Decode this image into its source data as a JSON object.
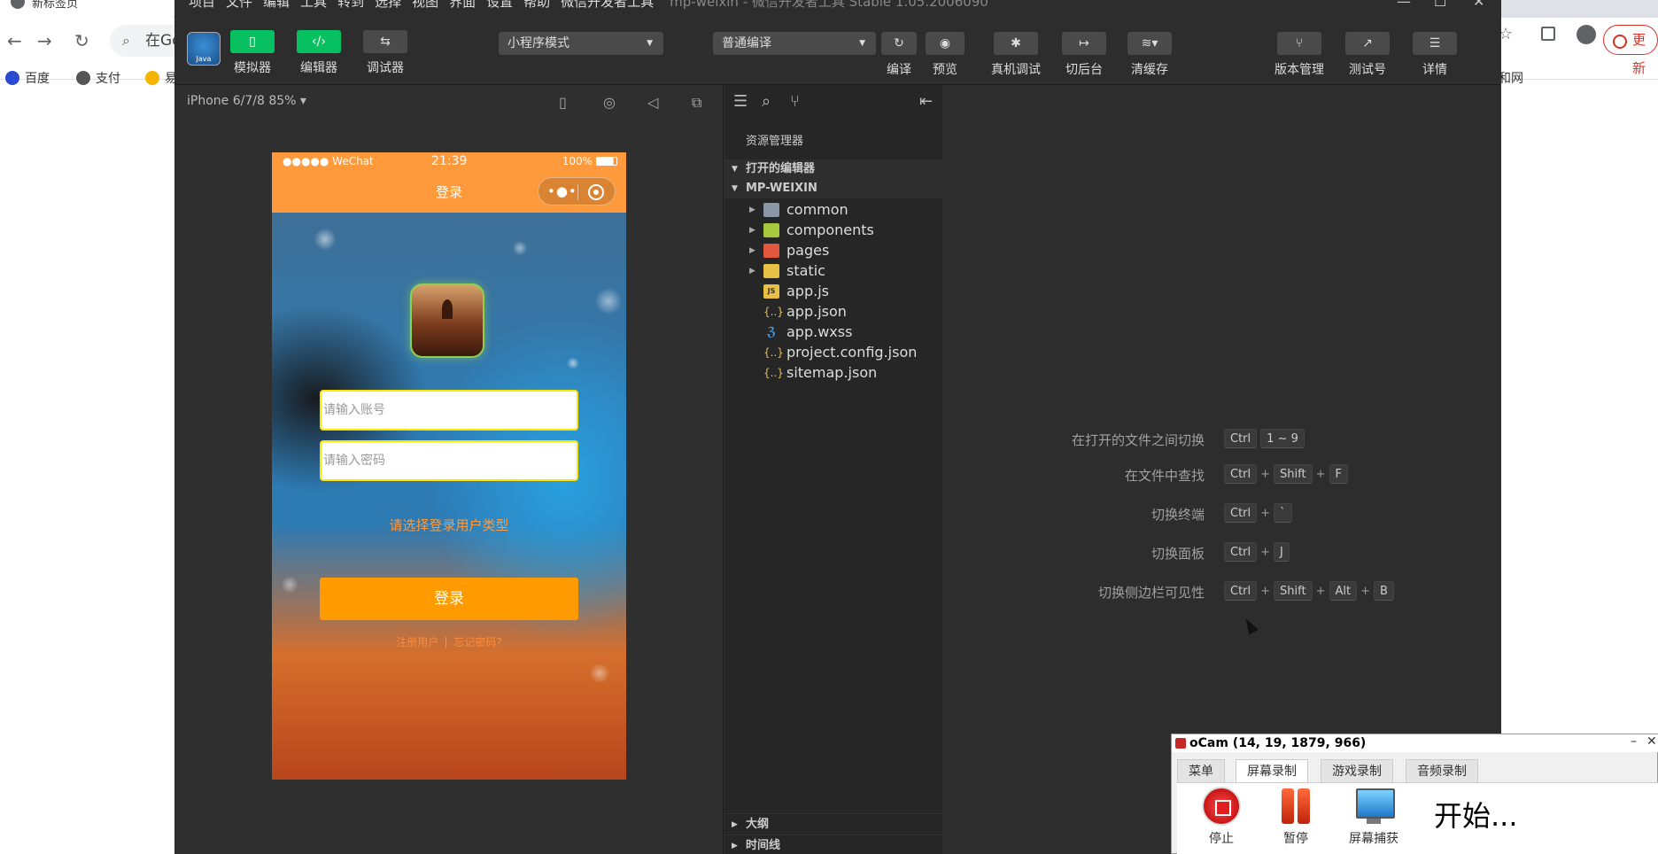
{
  "browser": {
    "tab_title": "新标签页",
    "omnibox_text": "在Go",
    "bookmarks": [
      "百度",
      "支付",
      "易"
    ],
    "update_label": "更新",
    "right_bookmark": "和网"
  },
  "ide": {
    "menu": [
      "项目",
      "文件",
      "编辑",
      "工具",
      "转到",
      "选择",
      "视图",
      "界面",
      "设置",
      "帮助",
      "微信开发者工具"
    ],
    "window_title": "mp-weixin - 微信开发者工具 Stable 1.05.2006090",
    "toolbar": {
      "avatar_text": "Java",
      "simulator": "模拟器",
      "editor": "编辑器",
      "debugger": "调试器",
      "mode_select": "小程序模式",
      "compile_select": "普通编译",
      "compile": "编译",
      "preview": "预览",
      "real_debug": "真机调试",
      "backend": "切后台",
      "clear_cache": "清缓存",
      "version": "版本管理",
      "test_id": "测试号",
      "details": "详情"
    },
    "simulator": {
      "device": "iPhone 6/7/8 85% ▾",
      "status_left": "●●●●● WeChat",
      "status_time": "21:39",
      "status_battery": "100%",
      "nav_title": "登录",
      "account_placeholder": "请输入账号",
      "password_placeholder": "请输入密码",
      "login_type": "请选择登录用户类型",
      "login_button": "登录",
      "register_link": "注册用户",
      "forgot_link": "忘记密码?"
    },
    "explorer": {
      "title": "资源管理器",
      "open_editors": "打开的编辑器",
      "project": "MP-WEIXIN",
      "items": [
        {
          "name": "common",
          "type": "folder"
        },
        {
          "name": "components",
          "type": "folder-green"
        },
        {
          "name": "pages",
          "type": "folder-red"
        },
        {
          "name": "static",
          "type": "folder-yellow"
        },
        {
          "name": "app.js",
          "type": "js"
        },
        {
          "name": "app.json",
          "type": "json"
        },
        {
          "name": "app.wxss",
          "type": "css"
        },
        {
          "name": "project.config.json",
          "type": "json"
        },
        {
          "name": "sitemap.json",
          "type": "json"
        }
      ],
      "outline": "大纲",
      "timeline": "时间线"
    },
    "shortcuts": [
      {
        "label": "在打开的文件之间切换",
        "keys": [
          "Ctrl",
          "1 ~ 9"
        ]
      },
      {
        "label": "在文件中查找",
        "keys": [
          "Ctrl",
          "Shift",
          "F"
        ]
      },
      {
        "label": "切换终端",
        "keys": [
          "Ctrl",
          "`"
        ]
      },
      {
        "label": "切换面板",
        "keys": [
          "Ctrl",
          "J"
        ]
      },
      {
        "label": "切换侧边栏可见性",
        "keys": [
          "Ctrl",
          "Shift",
          "Alt",
          "B"
        ]
      }
    ]
  },
  "ocam": {
    "title": "oCam (14, 19, 1879, 966)",
    "tabs": [
      "菜单",
      "屏幕录制",
      "游戏录制",
      "音频录制"
    ],
    "active_tab": "屏幕录制",
    "stop": "停止",
    "pause": "暂停",
    "capture": "屏幕捕获",
    "start_text": "开始..."
  },
  "colors": {
    "accent_green": "#07c160",
    "phone_orange": "#ff9a3c",
    "ide_bg": "#2d2d2d"
  }
}
